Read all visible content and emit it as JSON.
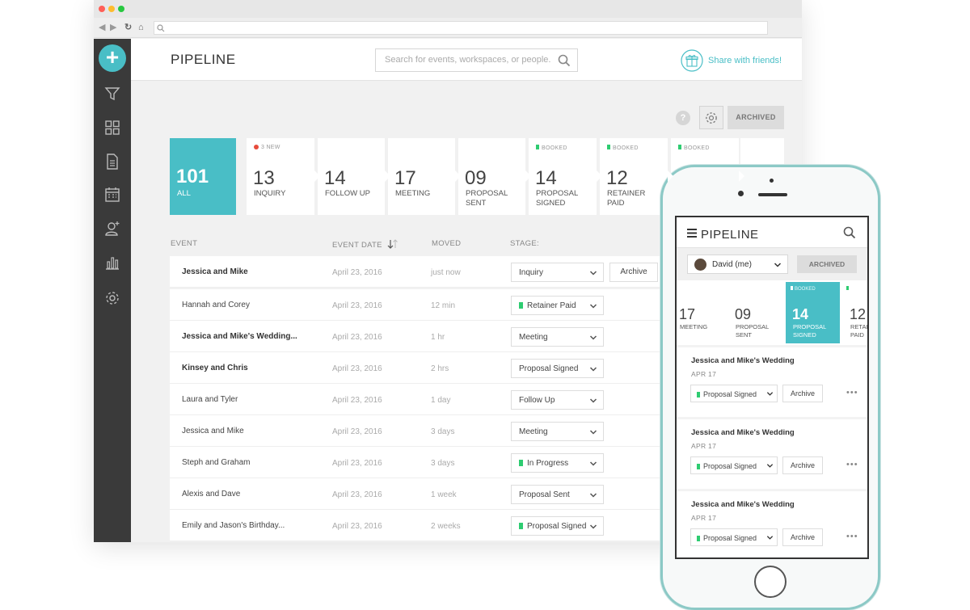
{
  "colors": {
    "accent": "#49bec6",
    "booked_flag": "#2ecc71",
    "new_dot": "#e74c3c",
    "sidebar": "#3a3a3a"
  },
  "header": {
    "title": "PIPELINE",
    "search_placeholder": "Search for events, workspaces, or people...",
    "share_label": "Share with friends!"
  },
  "controls": {
    "help_label": "?",
    "archived_label": "ARCHIVED"
  },
  "stages": [
    {
      "count": "101",
      "label": "ALL",
      "tag": ""
    },
    {
      "count": "13",
      "label": "INQUIRY",
      "tag": "3 NEW"
    },
    {
      "count": "14",
      "label": "FOLLOW UP",
      "tag": ""
    },
    {
      "count": "17",
      "label": "MEETING",
      "tag": ""
    },
    {
      "count": "09",
      "label": "PROPOSAL SENT",
      "tag": ""
    },
    {
      "count": "14",
      "label": "PROPOSAL SIGNED",
      "tag": "BOOKED"
    },
    {
      "count": "12",
      "label": "RETAINER PAID",
      "tag": "BOOKED"
    },
    {
      "count": "",
      "label": "",
      "tag": "BOOKED"
    }
  ],
  "table": {
    "columns": {
      "event": "EVENT",
      "date": "EVENT DATE",
      "moved": "MOVED",
      "stage": "STAGE:"
    },
    "archive_label": "Archive",
    "rows": [
      {
        "event": "Jessica and Mike",
        "date": "April 23, 2016",
        "moved": "just now",
        "stage": "Inquiry"
      },
      {
        "event": "Hannah and Corey",
        "date": "April 23, 2016",
        "moved": "12 min",
        "stage": "Retainer Paid"
      },
      {
        "event": "Jessica and Mike's Wedding...",
        "date": "April 23, 2016",
        "moved": "1 hr",
        "stage": "Meeting"
      },
      {
        "event": "Kinsey and Chris",
        "date": "April 23, 2016",
        "moved": "2 hrs",
        "stage": "Proposal Signed"
      },
      {
        "event": "Laura and Tyler",
        "date": "April 23, 2016",
        "moved": "1 day",
        "stage": "Follow Up"
      },
      {
        "event": "Jessica and Mike",
        "date": "April 23, 2016",
        "moved": "3 days",
        "stage": "Meeting"
      },
      {
        "event": "Steph and Graham",
        "date": "April 23, 2016",
        "moved": "3 days",
        "stage": "In Progress"
      },
      {
        "event": "Alexis and Dave",
        "date": "April 23, 2016",
        "moved": "1 week",
        "stage": "Proposal Sent"
      },
      {
        "event": "Emily and Jason's Birthday...",
        "date": "April 23, 2016",
        "moved": "2 weeks",
        "stage": "Proposal Signed"
      }
    ]
  },
  "mobile": {
    "title": "PIPELINE",
    "user_filter": "David (me)",
    "archived_label": "ARCHIVED",
    "stages": [
      {
        "count": "17",
        "label": "MEETING",
        "tag": ""
      },
      {
        "count": "09",
        "label": "PROPOSAL SENT",
        "tag": ""
      },
      {
        "count": "14",
        "label": "PROPOSAL SIGNED",
        "tag": "BOOKED"
      },
      {
        "count": "12",
        "label": "RETAINER PAID",
        "tag": ""
      }
    ],
    "cards": [
      {
        "title": "Jessica and Mike's Wedding",
        "date": "APR 17",
        "stage": "Proposal Signed",
        "archive": "Archive",
        "more": "•••"
      },
      {
        "title": "Jessica and Mike's Wedding",
        "date": "APR 17",
        "stage": "Proposal Signed",
        "archive": "Archive",
        "more": "•••"
      },
      {
        "title": "Jessica and Mike's Wedding",
        "date": "APR 17",
        "stage": "Proposal Signed",
        "archive": "Archive",
        "more": "•••"
      }
    ]
  }
}
